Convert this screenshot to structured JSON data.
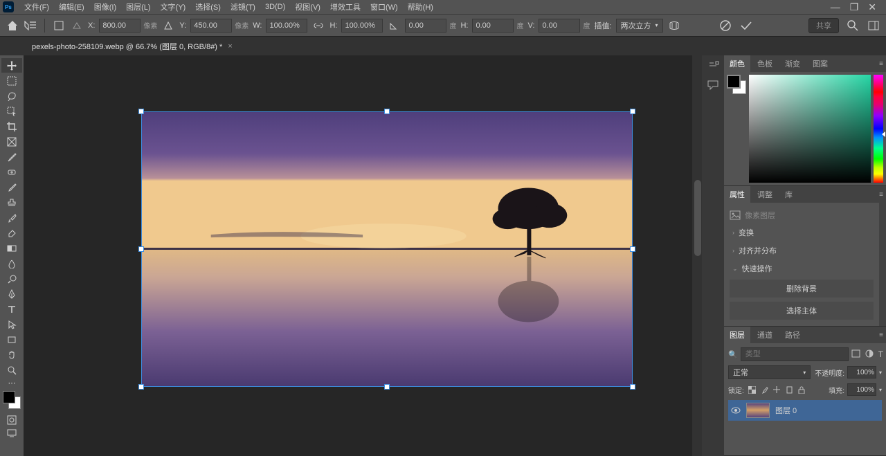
{
  "menu": {
    "items": [
      "文件(F)",
      "编辑(E)",
      "图像(I)",
      "图层(L)",
      "文字(Y)",
      "选择(S)",
      "滤镜(T)",
      "3D(D)",
      "视图(V)",
      "增效工具",
      "窗口(W)",
      "帮助(H)"
    ]
  },
  "options": {
    "x_label": "X:",
    "x_value": "800.00",
    "x_unit": "像素",
    "y_label": "Y:",
    "y_value": "450.00",
    "y_unit": "像素",
    "w_label": "W:",
    "w_value": "100.00%",
    "h_label": "H:",
    "h_value": "100.00%",
    "angle_value": "0.00",
    "angle_unit": "度",
    "skew_h_label": "H:",
    "skew_h_value": "0.00",
    "skew_h_unit": "度",
    "skew_v_label": "V:",
    "skew_v_value": "0.00",
    "skew_v_unit": "度",
    "interp_label": "插值:",
    "interp_value": "两次立方",
    "share_label": "共享"
  },
  "tabs": {
    "doc_title": "pexels-photo-258109.webp @ 66.7% (图层 0, RGB/8#) *"
  },
  "color_panel": {
    "tabs": [
      "颜色",
      "色板",
      "渐变",
      "图案"
    ]
  },
  "props_panel": {
    "tabs": [
      "属性",
      "调整",
      "库"
    ],
    "pixel_layer_label": "像素图层",
    "sections": {
      "transform": "变换",
      "align": "对齐并分布",
      "quick": "快速操作"
    },
    "remove_bg_btn": "删除背景",
    "select_subject_btn": "选择主体"
  },
  "layers_panel": {
    "tabs": [
      "图层",
      "通道",
      "路径"
    ],
    "search_placeholder": "类型",
    "blend_mode": "正常",
    "opacity_label": "不透明度:",
    "opacity_value": "100%",
    "lock_label": "锁定:",
    "fill_label": "填充:",
    "fill_value": "100%",
    "layer0_name": "图层 0"
  }
}
